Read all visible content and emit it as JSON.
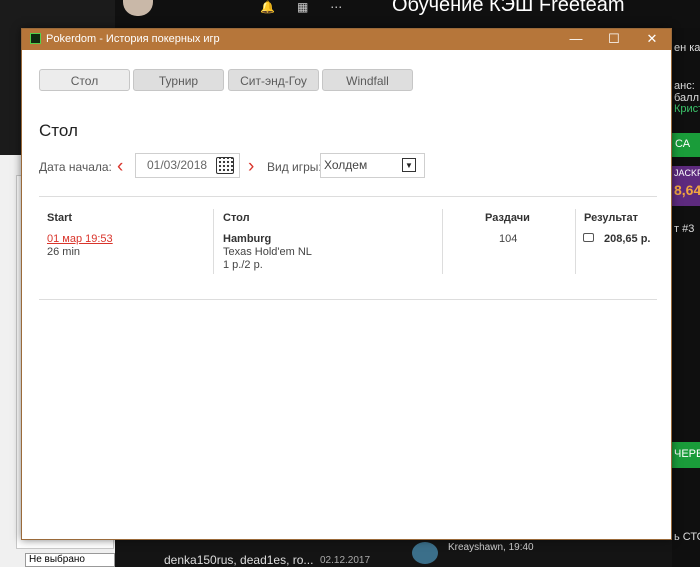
{
  "background": {
    "title": "Обучение КЭШ Freeteam",
    "icons": [
      "bell-icon",
      "grid-icon",
      "dots-icon"
    ],
    "right_snippets": [
      "ен как",
      "анс:",
      "балл",
      "Крист",
      "СА",
      "JACKF",
      "8,64",
      "т #3",
      "ЧЕРЕД",
      "ь СТО"
    ],
    "left_select": "Не выбрано",
    "chat": {
      "users": "denka150rus, dead1es, ro...",
      "date": "02.12.2017",
      "author_time": "Kreayshawn, 19:40"
    }
  },
  "window": {
    "title": "Pokerdom - История покерных игр",
    "buttons": {
      "minimize": "—",
      "maximize": "☐",
      "close": "✕"
    }
  },
  "tabs": [
    {
      "label": "Стол",
      "active": true
    },
    {
      "label": "Турнир",
      "active": false
    },
    {
      "label": "Сит-энд-Гоу",
      "active": false
    },
    {
      "label": "Windfall",
      "active": false
    }
  ],
  "section_title": "Стол",
  "filters": {
    "start_date_label": "Дата начала:",
    "start_date_value": "01/03/2018",
    "game_type_label": "Вид игры:",
    "game_type_value": "Холдем"
  },
  "table": {
    "headers": {
      "start": "Start",
      "table": "Стол",
      "hands": "Раздачи",
      "result": "Результат"
    },
    "rows": [
      {
        "start_link": "01 мар 19:53",
        "duration": "26 min",
        "table_name": "Hamburg",
        "game": "Texas Hold'em NL",
        "stakes": "1 р./2 р.",
        "hands": "104",
        "result": "208,65 р."
      }
    ]
  },
  "colors": {
    "titlebar": "#b6763a",
    "accent_red": "#d9342b"
  }
}
